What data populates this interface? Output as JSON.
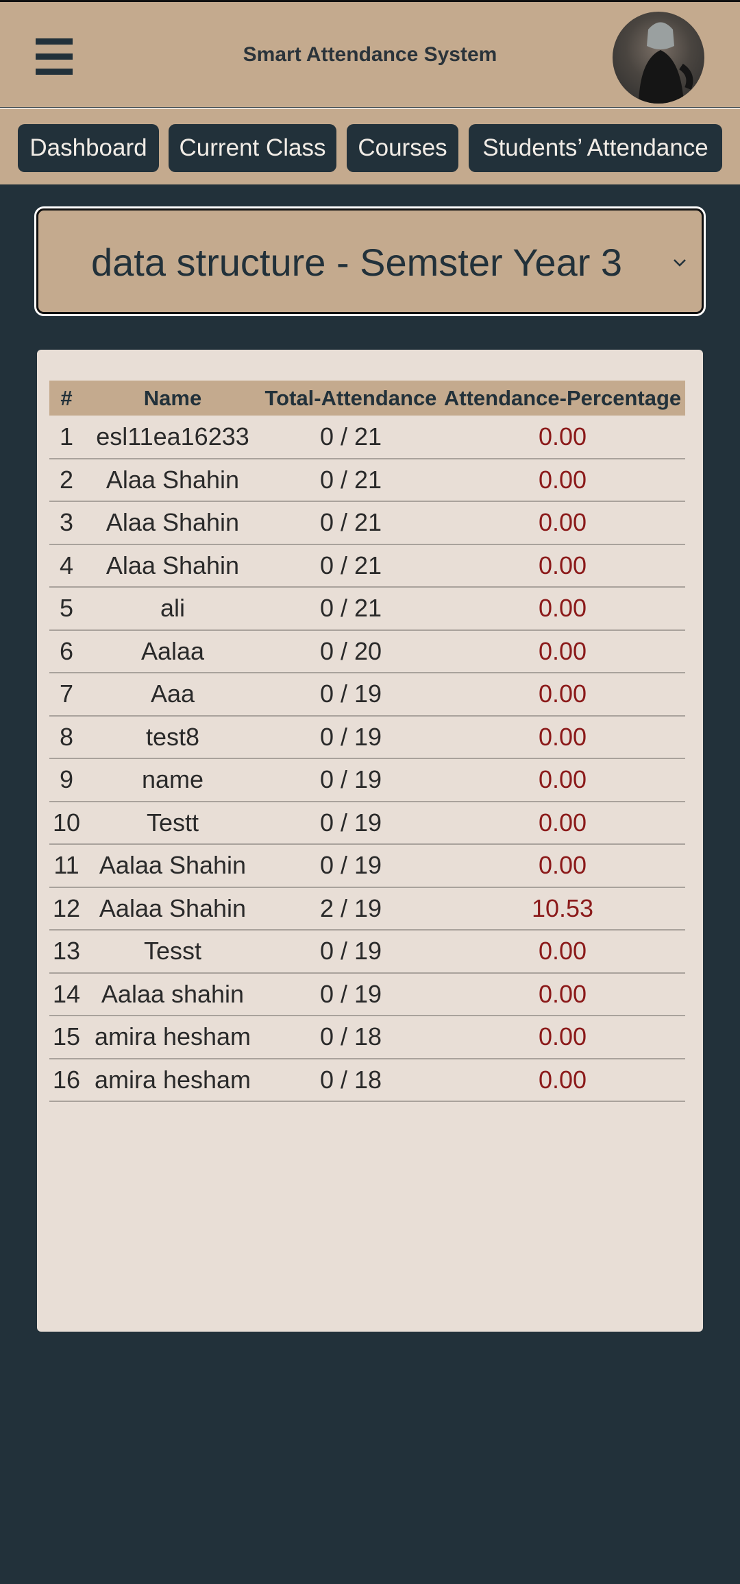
{
  "header": {
    "title": "Smart Attendance System"
  },
  "nav": {
    "tabs": [
      {
        "label": "Dashboard"
      },
      {
        "label": "Current Class"
      },
      {
        "label": "Courses"
      },
      {
        "label": "Students’ Attendance"
      }
    ]
  },
  "course_select": {
    "selected": "data structure - Semster Year 3"
  },
  "table": {
    "headers": [
      "#",
      "Name",
      "Total-Attendance",
      "Attendance-Percentage"
    ],
    "rows": [
      [
        "1",
        "esl11ea16233",
        "0 / 21",
        "0.00"
      ],
      [
        "2",
        "Alaa Shahin",
        "0 / 21",
        "0.00"
      ],
      [
        "3",
        "Alaa Shahin",
        "0 / 21",
        "0.00"
      ],
      [
        "4",
        "Alaa Shahin",
        "0 / 21",
        "0.00"
      ],
      [
        "5",
        "ali",
        "0 / 21",
        "0.00"
      ],
      [
        "6",
        "Aalaa",
        "0 / 20",
        "0.00"
      ],
      [
        "7",
        "Aaa",
        "0 / 19",
        "0.00"
      ],
      [
        "8",
        "test8",
        "0 / 19",
        "0.00"
      ],
      [
        "9",
        "name",
        "0 / 19",
        "0.00"
      ],
      [
        "10",
        "Testt",
        "0 / 19",
        "0.00"
      ],
      [
        "11",
        "Aalaa Shahin",
        "0 / 19",
        "0.00"
      ],
      [
        "12",
        "Aalaa Shahin",
        "2 / 19",
        "10.53"
      ],
      [
        "13",
        "Tesst",
        "0 / 19",
        "0.00"
      ],
      [
        "14",
        "Aalaa shahin",
        "0 / 19",
        "0.00"
      ],
      [
        "15",
        "amira hesham",
        "0 / 18",
        "0.00"
      ],
      [
        "16",
        "amira hesham",
        "0 / 18",
        "0.00"
      ]
    ]
  },
  "colors": {
    "tan": "#c4aa8e",
    "navy": "#22313a",
    "panel": "#e8ded6",
    "percent_text": "#8b1a1a"
  }
}
